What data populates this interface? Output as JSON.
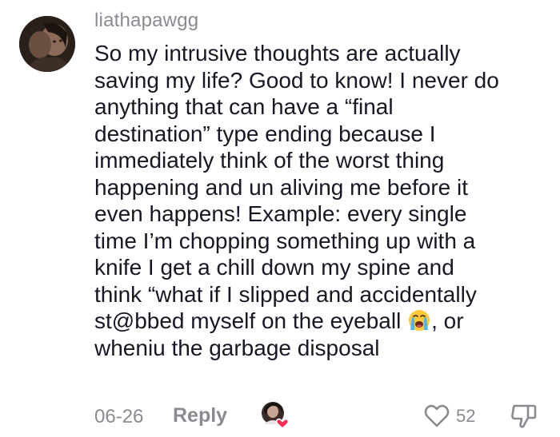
{
  "comment": {
    "username": "liathapawgg",
    "text_lines": [
      "So my intrusive thoughts are actually",
      "saving my life? Good to know! I never do",
      "anything that can have a “final",
      "destination” type ending because I",
      "immediately think of the worst thing",
      "happening and un aliving me before it",
      "even happens! Example: every single",
      "time I’m chopping something up with a",
      "knife I get a chill down my spine and",
      "think “what if I slipped and accidentally"
    ],
    "line_with_emoji_before": "st@bbed myself on the eyeball ",
    "line_with_emoji_after": ", or",
    "last_line": "wheniu the garbage disposal",
    "emoji": "loudly-crying-face",
    "date": "06-26",
    "reply_label": "Reply",
    "like_count": "52"
  },
  "icons": {
    "avatar": "user-avatar",
    "creator_liked": "creator-liked-avatar-icon",
    "like": "heart-outline-icon",
    "dislike": "thumbs-down-outline-icon"
  },
  "colors": {
    "text": "#161823",
    "muted": "#8a8b91",
    "creator_heart": "#fe2c55"
  }
}
